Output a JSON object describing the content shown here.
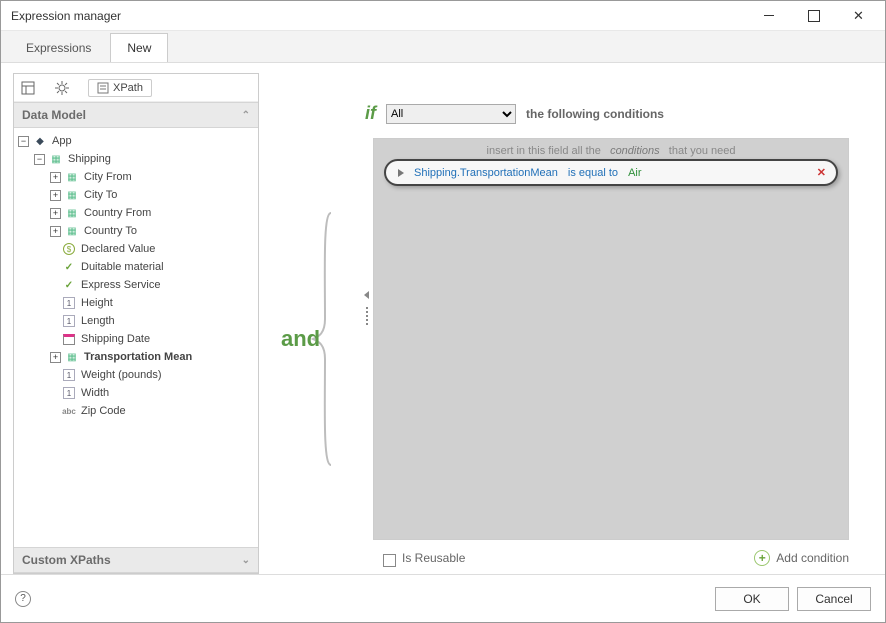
{
  "window": {
    "title": "Expression manager"
  },
  "tabs": {
    "expressions": "Expressions",
    "new": "New",
    "active": "New"
  },
  "leftpane": {
    "xpath_btn": "XPath",
    "data_model_header": "Data Model",
    "custom_xpaths_header": "Custom XPaths",
    "tree": {
      "app": "App",
      "shipping": "Shipping",
      "items": [
        {
          "icon": "grid",
          "label": "City From",
          "expandable": true
        },
        {
          "icon": "grid",
          "label": "City To",
          "expandable": true
        },
        {
          "icon": "grid",
          "label": "Country From",
          "expandable": true
        },
        {
          "icon": "grid",
          "label": "Country To",
          "expandable": true
        },
        {
          "icon": "dollar",
          "label": "Declared Value",
          "expandable": false
        },
        {
          "icon": "check",
          "label": "Duitable material",
          "expandable": false
        },
        {
          "icon": "check",
          "label": "Express Service",
          "expandable": false
        },
        {
          "icon": "one",
          "label": "Height",
          "expandable": false
        },
        {
          "icon": "one",
          "label": "Length",
          "expandable": false
        },
        {
          "icon": "calendar",
          "label": "Shipping Date",
          "expandable": false
        },
        {
          "icon": "grid",
          "label": "Transportation Mean",
          "expandable": true,
          "bold": true
        },
        {
          "icon": "one",
          "label": "Weight (pounds)",
          "expandable": false
        },
        {
          "icon": "one",
          "label": "Width",
          "expandable": false
        },
        {
          "icon": "abc",
          "label": "Zip Code",
          "expandable": false
        }
      ]
    }
  },
  "condition": {
    "if_label": "if",
    "scope_options": [
      "All"
    ],
    "scope_selected": "All",
    "following_label": "the following conditions",
    "hint_prefix": "insert in this field all the",
    "hint_italic": "conditions",
    "hint_suffix": "that you need",
    "and_label": "and",
    "row": {
      "field": "Shipping.TransportationMean",
      "operator": "is equal to",
      "value": "Air"
    },
    "is_reusable_label": "Is Reusable",
    "add_condition_label": "Add condition"
  },
  "footer": {
    "ok": "OK",
    "cancel": "Cancel"
  }
}
